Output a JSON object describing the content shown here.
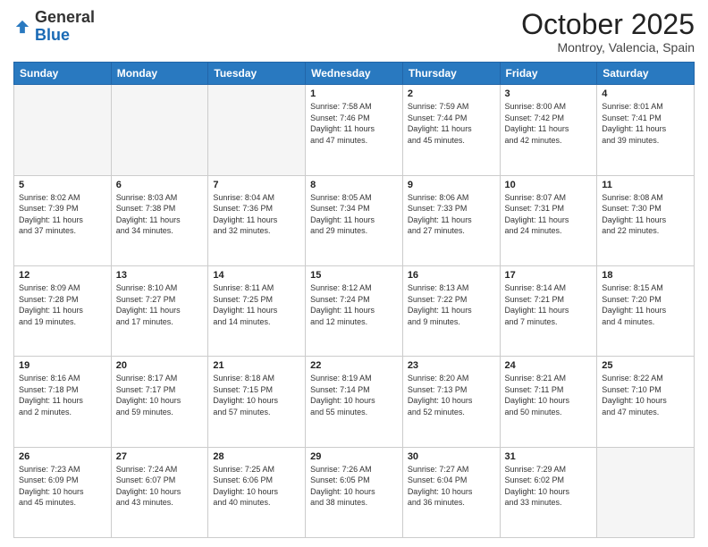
{
  "header": {
    "logo_general": "General",
    "logo_blue": "Blue",
    "month_title": "October 2025",
    "subtitle": "Montroy, Valencia, Spain"
  },
  "weekdays": [
    "Sunday",
    "Monday",
    "Tuesday",
    "Wednesday",
    "Thursday",
    "Friday",
    "Saturday"
  ],
  "weeks": [
    [
      {
        "day": "",
        "info": ""
      },
      {
        "day": "",
        "info": ""
      },
      {
        "day": "",
        "info": ""
      },
      {
        "day": "1",
        "info": "Sunrise: 7:58 AM\nSunset: 7:46 PM\nDaylight: 11 hours\nand 47 minutes."
      },
      {
        "day": "2",
        "info": "Sunrise: 7:59 AM\nSunset: 7:44 PM\nDaylight: 11 hours\nand 45 minutes."
      },
      {
        "day": "3",
        "info": "Sunrise: 8:00 AM\nSunset: 7:42 PM\nDaylight: 11 hours\nand 42 minutes."
      },
      {
        "day": "4",
        "info": "Sunrise: 8:01 AM\nSunset: 7:41 PM\nDaylight: 11 hours\nand 39 minutes."
      }
    ],
    [
      {
        "day": "5",
        "info": "Sunrise: 8:02 AM\nSunset: 7:39 PM\nDaylight: 11 hours\nand 37 minutes."
      },
      {
        "day": "6",
        "info": "Sunrise: 8:03 AM\nSunset: 7:38 PM\nDaylight: 11 hours\nand 34 minutes."
      },
      {
        "day": "7",
        "info": "Sunrise: 8:04 AM\nSunset: 7:36 PM\nDaylight: 11 hours\nand 32 minutes."
      },
      {
        "day": "8",
        "info": "Sunrise: 8:05 AM\nSunset: 7:34 PM\nDaylight: 11 hours\nand 29 minutes."
      },
      {
        "day": "9",
        "info": "Sunrise: 8:06 AM\nSunset: 7:33 PM\nDaylight: 11 hours\nand 27 minutes."
      },
      {
        "day": "10",
        "info": "Sunrise: 8:07 AM\nSunset: 7:31 PM\nDaylight: 11 hours\nand 24 minutes."
      },
      {
        "day": "11",
        "info": "Sunrise: 8:08 AM\nSunset: 7:30 PM\nDaylight: 11 hours\nand 22 minutes."
      }
    ],
    [
      {
        "day": "12",
        "info": "Sunrise: 8:09 AM\nSunset: 7:28 PM\nDaylight: 11 hours\nand 19 minutes."
      },
      {
        "day": "13",
        "info": "Sunrise: 8:10 AM\nSunset: 7:27 PM\nDaylight: 11 hours\nand 17 minutes."
      },
      {
        "day": "14",
        "info": "Sunrise: 8:11 AM\nSunset: 7:25 PM\nDaylight: 11 hours\nand 14 minutes."
      },
      {
        "day": "15",
        "info": "Sunrise: 8:12 AM\nSunset: 7:24 PM\nDaylight: 11 hours\nand 12 minutes."
      },
      {
        "day": "16",
        "info": "Sunrise: 8:13 AM\nSunset: 7:22 PM\nDaylight: 11 hours\nand 9 minutes."
      },
      {
        "day": "17",
        "info": "Sunrise: 8:14 AM\nSunset: 7:21 PM\nDaylight: 11 hours\nand 7 minutes."
      },
      {
        "day": "18",
        "info": "Sunrise: 8:15 AM\nSunset: 7:20 PM\nDaylight: 11 hours\nand 4 minutes."
      }
    ],
    [
      {
        "day": "19",
        "info": "Sunrise: 8:16 AM\nSunset: 7:18 PM\nDaylight: 11 hours\nand 2 minutes."
      },
      {
        "day": "20",
        "info": "Sunrise: 8:17 AM\nSunset: 7:17 PM\nDaylight: 10 hours\nand 59 minutes."
      },
      {
        "day": "21",
        "info": "Sunrise: 8:18 AM\nSunset: 7:15 PM\nDaylight: 10 hours\nand 57 minutes."
      },
      {
        "day": "22",
        "info": "Sunrise: 8:19 AM\nSunset: 7:14 PM\nDaylight: 10 hours\nand 55 minutes."
      },
      {
        "day": "23",
        "info": "Sunrise: 8:20 AM\nSunset: 7:13 PM\nDaylight: 10 hours\nand 52 minutes."
      },
      {
        "day": "24",
        "info": "Sunrise: 8:21 AM\nSunset: 7:11 PM\nDaylight: 10 hours\nand 50 minutes."
      },
      {
        "day": "25",
        "info": "Sunrise: 8:22 AM\nSunset: 7:10 PM\nDaylight: 10 hours\nand 47 minutes."
      }
    ],
    [
      {
        "day": "26",
        "info": "Sunrise: 7:23 AM\nSunset: 6:09 PM\nDaylight: 10 hours\nand 45 minutes."
      },
      {
        "day": "27",
        "info": "Sunrise: 7:24 AM\nSunset: 6:07 PM\nDaylight: 10 hours\nand 43 minutes."
      },
      {
        "day": "28",
        "info": "Sunrise: 7:25 AM\nSunset: 6:06 PM\nDaylight: 10 hours\nand 40 minutes."
      },
      {
        "day": "29",
        "info": "Sunrise: 7:26 AM\nSunset: 6:05 PM\nDaylight: 10 hours\nand 38 minutes."
      },
      {
        "day": "30",
        "info": "Sunrise: 7:27 AM\nSunset: 6:04 PM\nDaylight: 10 hours\nand 36 minutes."
      },
      {
        "day": "31",
        "info": "Sunrise: 7:29 AM\nSunset: 6:02 PM\nDaylight: 10 hours\nand 33 minutes."
      },
      {
        "day": "",
        "info": ""
      }
    ]
  ]
}
